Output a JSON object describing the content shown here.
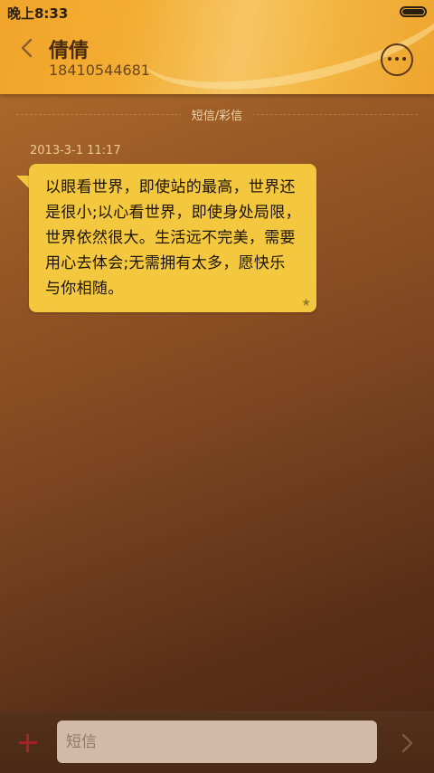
{
  "status_bar": {
    "time": "晚上8:33"
  },
  "header": {
    "contact_name": "倩倩",
    "contact_number": "18410544681"
  },
  "conversation": {
    "divider_label": "短信/彩信",
    "messages": [
      {
        "timestamp": "2013-3-1 11:17",
        "text": "以眼看世界，即使站的最高，世界还\n是很小;以心看世界，即使身处局限，\n世界依然很大。生活远不完美，需要\n用心去体会;无需拥有太多，愿快乐\n与你相随。",
        "starred": true
      }
    ]
  },
  "input_bar": {
    "placeholder": "短信"
  },
  "icons": {
    "back": "chevron-left-icon",
    "more": "more-dots-icon",
    "star": "star-icon",
    "add": "plus-icon",
    "send": "chevron-right-icon",
    "battery": "battery-icon"
  },
  "colors": {
    "header_accent": "#f3ad32",
    "bubble": "#f3c73e",
    "add_icon": "#a52326",
    "background_dark": "#5a2f18"
  }
}
